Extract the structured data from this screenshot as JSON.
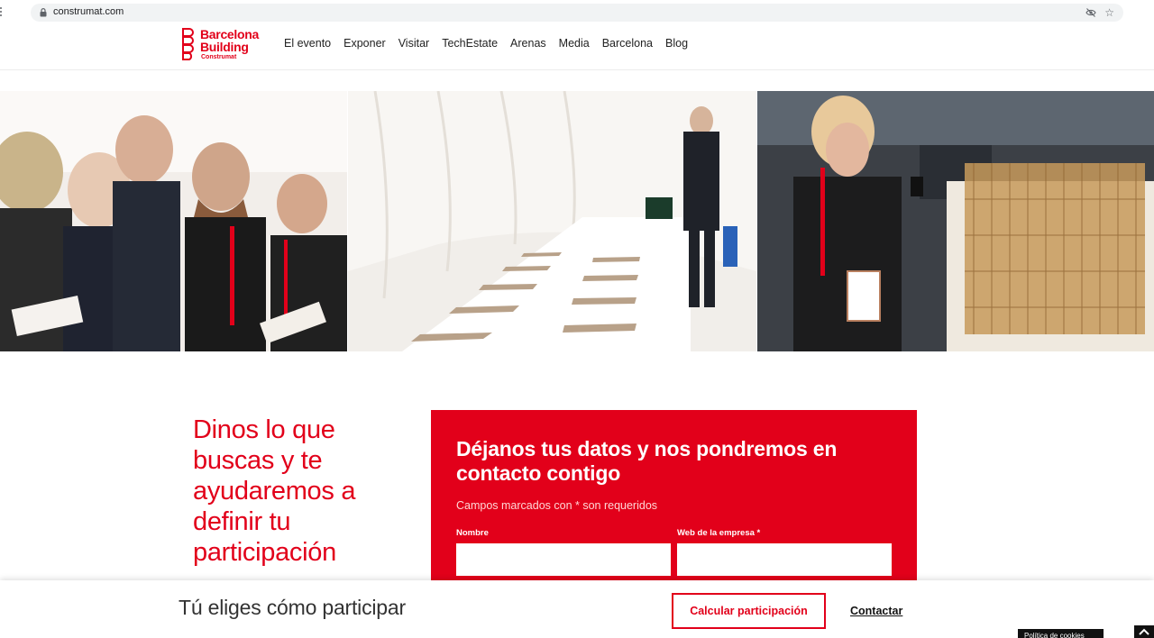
{
  "browser": {
    "url": "construmat.com"
  },
  "header": {
    "logo": {
      "line1": "Barcelona",
      "line2": "Building",
      "line3": "Construmat"
    },
    "nav": [
      "El evento",
      "Exponer",
      "Visitar",
      "TechEstate",
      "Arenas",
      "Media",
      "Barcelona",
      "Blog"
    ]
  },
  "main": {
    "lead_text": "Dinos lo que buscas y te ayudaremos a definir tu participación",
    "form": {
      "title": "Déjanos tus datos y nos pondremos en contacto contigo",
      "required_note": "Campos marcados con * son requeridos",
      "fields": [
        {
          "label": "Nombre",
          "value": ""
        },
        {
          "label": "Web de la empresa *",
          "value": ""
        }
      ]
    }
  },
  "sticky_bar": {
    "title": "Tú eliges cómo participar",
    "calc_button": "Calcular participación",
    "contact_link": "Contactar"
  },
  "cookie_tab": "Política de cookies",
  "colors": {
    "brand_red": "#e2001a"
  }
}
